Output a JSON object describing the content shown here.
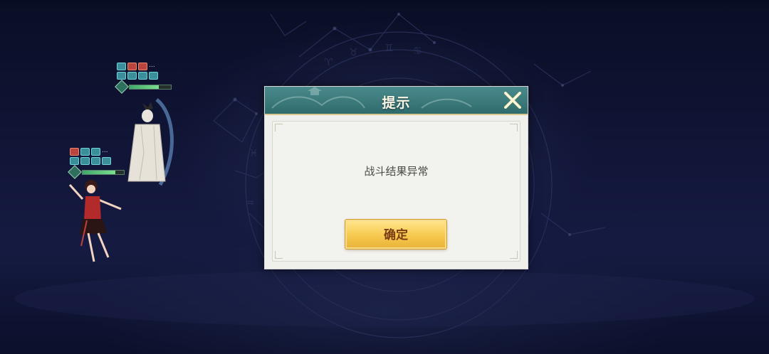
{
  "dialog": {
    "title": "提示",
    "message": "战斗结果异常",
    "confirm_label": "确定"
  },
  "units": [
    {
      "hp_fraction": 0.7,
      "buff_more": "..."
    },
    {
      "hp_fraction": 0.8,
      "buff_more": "..."
    }
  ],
  "colors": {
    "header": "#3a7a7c",
    "confirm": "#f6c94f",
    "background": "#161b44"
  },
  "icons": {
    "close": "close-x-icon"
  }
}
